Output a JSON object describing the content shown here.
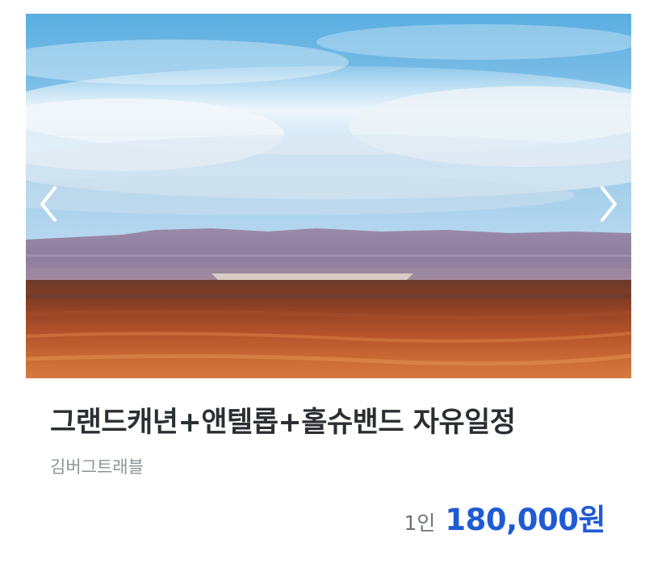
{
  "product": {
    "image_alt": "Grand Canyon desert landscape",
    "title": "그랜드캐년+앤텔롭+홀슈밴드 자유일정",
    "vendor": "김버그트래블",
    "price_unit": "1인",
    "price": "180,000원"
  },
  "carousel": {
    "prev_icon": "chevron-left-icon",
    "next_icon": "chevron-right-icon"
  },
  "colors": {
    "title": "#2b2f33",
    "vendor": "#8e9398",
    "price": "#1f5bd3"
  }
}
